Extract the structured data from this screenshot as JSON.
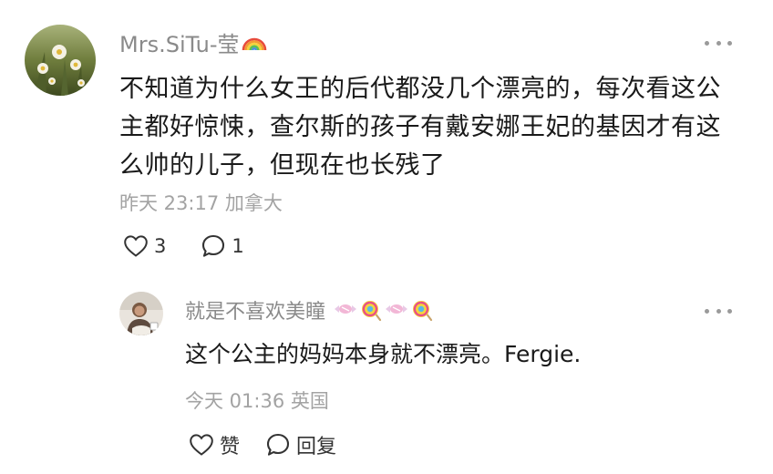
{
  "comments": [
    {
      "username": "Mrs.SiTu-莹",
      "username_emoji": "rainbow-icon",
      "text": "不知道为什么女王的后代都没几个漂亮的，每次看这公主都好惊悚，查尔斯的孩子有戴安娜王妃的基因才有这么帅的儿子，但现在也长残了",
      "meta": "昨天 23:17 加拿大",
      "like_count": "3",
      "reply_count": "1"
    },
    {
      "username": "就是不喜欢美瞳",
      "username_emoji": "candy-lollipop-icons",
      "text": "这个公主的妈妈本身就不漂亮。Fergie.",
      "meta": "今天 01:36 英国",
      "like_label": "赞",
      "reply_label": "回复"
    }
  ],
  "colors": {
    "username": "#8a8a8a",
    "text": "#1a1a1a",
    "meta": "#a3a3a3",
    "icon": "#333333"
  }
}
